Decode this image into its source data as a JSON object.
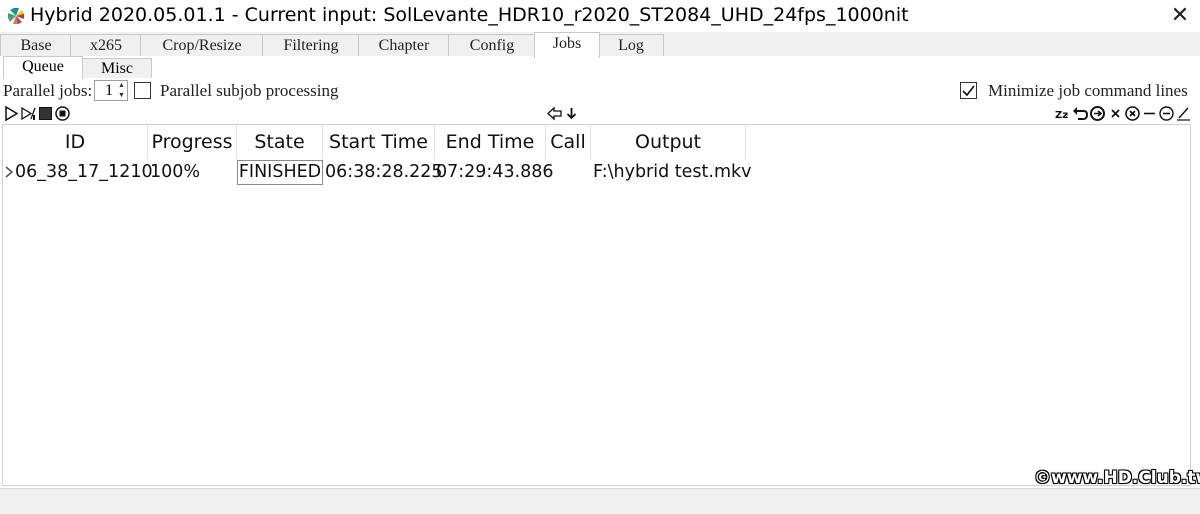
{
  "window": {
    "title": "Hybrid 2020.05.01.1 - Current input: SolLevante_HDR10_r2020_ST2084_UHD_24fps_1000nit",
    "close_label": "✕"
  },
  "tabs": [
    {
      "label": "Base"
    },
    {
      "label": "x265"
    },
    {
      "label": "Crop/Resize"
    },
    {
      "label": "Filtering"
    },
    {
      "label": "Chapter"
    },
    {
      "label": "Config"
    },
    {
      "label": "Jobs"
    },
    {
      "label": "Log"
    }
  ],
  "active_tab": "Jobs",
  "subtabs": [
    {
      "label": "Queue"
    },
    {
      "label": "Misc"
    }
  ],
  "active_subtab": "Queue",
  "options": {
    "parallel_jobs_label": "Parallel jobs:",
    "parallel_jobs_value": "1",
    "parallel_subjob_label": "Parallel subjob processing",
    "parallel_subjob_checked": false,
    "minimize_label": "Minimize job command lines",
    "minimize_checked": true
  },
  "toolbar": {
    "left_icons": [
      "play-icon",
      "skip-icon",
      "stop-icon",
      "stop-circle-icon"
    ],
    "center_icons": [
      "arrow-left-icon",
      "arrow-down-icon"
    ],
    "right_icons": [
      "sleep-icon",
      "undo-icon",
      "reset-icon",
      "remove-icon",
      "remove-circle-icon",
      "minus-icon",
      "minus-circle-icon",
      "edit-icon"
    ]
  },
  "table": {
    "columns": [
      "ID",
      "Progress",
      "State",
      "Start Time",
      "End Time",
      "Call",
      "Output"
    ],
    "rows": [
      {
        "id": "06_38_17_1210",
        "progress": "100%",
        "state": "FINISHED",
        "start_time": "06:38:28.225",
        "end_time": "07:29:43.886",
        "call": "",
        "output": "F:\\hybrid test.mkv"
      }
    ]
  },
  "watermark": "©www.HD.Club.tw"
}
